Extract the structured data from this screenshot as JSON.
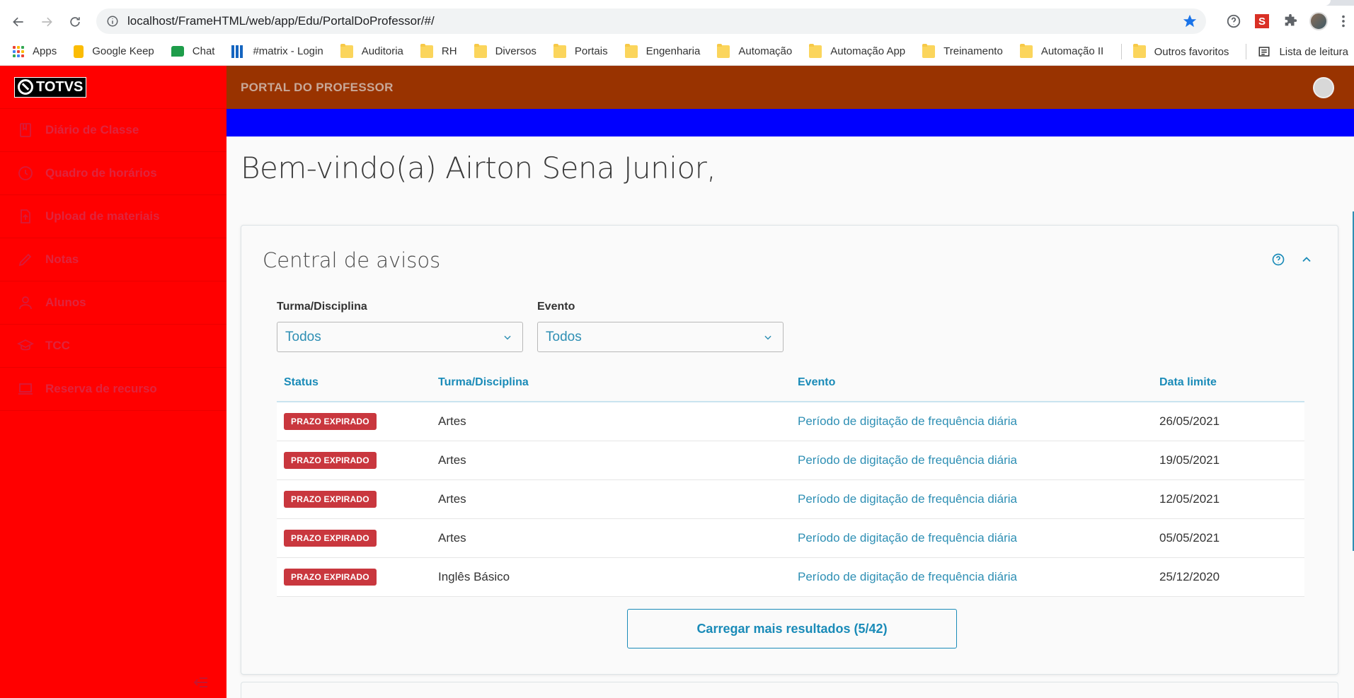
{
  "browser": {
    "url": "localhost/FrameHTML/web/app/Edu/PortalDoProfessor/#/",
    "bookmarks": [
      {
        "label": "Apps",
        "icon": "apps-grid-icon"
      },
      {
        "label": "Google Keep",
        "icon": "keep-icon"
      },
      {
        "label": "Chat",
        "icon": "chat-icon"
      },
      {
        "label": "#matrix - Login",
        "icon": "matrix-icon"
      },
      {
        "label": "Auditoria",
        "icon": "folder-icon"
      },
      {
        "label": "RH",
        "icon": "folder-icon"
      },
      {
        "label": "Diversos",
        "icon": "folder-icon"
      },
      {
        "label": "Portais",
        "icon": "folder-icon"
      },
      {
        "label": "Engenharia",
        "icon": "folder-icon"
      },
      {
        "label": "Automação",
        "icon": "folder-icon"
      },
      {
        "label": "Automação App",
        "icon": "folder-icon"
      },
      {
        "label": "Treinamento",
        "icon": "folder-icon"
      },
      {
        "label": "Automação II",
        "icon": "folder-icon"
      }
    ],
    "other_bookmarks": "Outros favoritos",
    "reading_list": "Lista de leitura"
  },
  "app": {
    "logo_text": "TOTVS",
    "header_title": "PORTAL DO PROFESSOR",
    "colors": {
      "sidebar": "#ff0000",
      "header": "#993300",
      "banner": "#0000ff",
      "accent": "#2e8fb4",
      "badge": "#c9373e"
    }
  },
  "sidebar": {
    "items": [
      {
        "label": "Diário de Classe",
        "icon": "book-icon"
      },
      {
        "label": "Quadro de horários",
        "icon": "clock-icon"
      },
      {
        "label": "Upload de materiais",
        "icon": "upload-file-icon"
      },
      {
        "label": "Notas",
        "icon": "pencil-icon"
      },
      {
        "label": "Alunos",
        "icon": "user-icon"
      },
      {
        "label": "TCC",
        "icon": "graduation-cap-icon"
      },
      {
        "label": "Reserva de recurso",
        "icon": "laptop-icon"
      }
    ]
  },
  "main": {
    "welcome": "Bem-vindo(a) Airton Sena Junior,",
    "notices": {
      "title": "Central de avisos",
      "filters": {
        "turma_label": "Turma/Disciplina",
        "turma_value": "Todos",
        "evento_label": "Evento",
        "evento_value": "Todos"
      },
      "columns": [
        "Status",
        "Turma/Disciplina",
        "Evento",
        "Data limite"
      ],
      "rows": [
        {
          "status": "PRAZO EXPIRADO",
          "turma": "Artes",
          "evento": "Período de digitação de frequência diária",
          "data": "26/05/2021"
        },
        {
          "status": "PRAZO EXPIRADO",
          "turma": "Artes",
          "evento": "Período de digitação de frequência diária",
          "data": "19/05/2021"
        },
        {
          "status": "PRAZO EXPIRADO",
          "turma": "Artes",
          "evento": "Período de digitação de frequência diária",
          "data": "12/05/2021"
        },
        {
          "status": "PRAZO EXPIRADO",
          "turma": "Artes",
          "evento": "Período de digitação de frequência diária",
          "data": "05/05/2021"
        },
        {
          "status": "PRAZO EXPIRADO",
          "turma": "Inglês Básico",
          "evento": "Período de digitação de frequência diária",
          "data": "25/12/2020"
        }
      ],
      "load_more": "Carregar mais resultados (5/42)"
    }
  }
}
